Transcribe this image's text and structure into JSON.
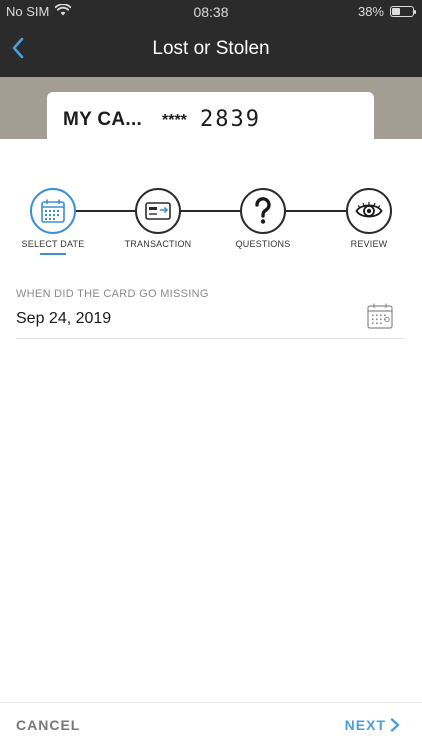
{
  "status_bar": {
    "carrier": "No SIM",
    "time": "08:38",
    "battery": "38%",
    "battery_level": 0.38
  },
  "header": {
    "title": "Lost or Stolen"
  },
  "card": {
    "name": "MY CA...",
    "mask": "****",
    "last4": "2839"
  },
  "stepper": {
    "steps": [
      {
        "label": "SELECT DATE",
        "icon": "calendar-icon",
        "active": true
      },
      {
        "label": "TRANSACTION",
        "icon": "credit-card-icon",
        "active": false
      },
      {
        "label": "QUESTIONS",
        "icon": "question-icon",
        "active": false
      },
      {
        "label": "REVIEW",
        "icon": "eye-icon",
        "active": false
      }
    ]
  },
  "field": {
    "label": "WHEN DID THE CARD GO MISSING",
    "value": "Sep 24, 2019"
  },
  "footer": {
    "cancel": "CANCEL",
    "next": "NEXT"
  },
  "colors": {
    "accent": "#3e8ed0",
    "header_bg": "#2b2b2b",
    "card_area_bg": "#a49d93"
  }
}
